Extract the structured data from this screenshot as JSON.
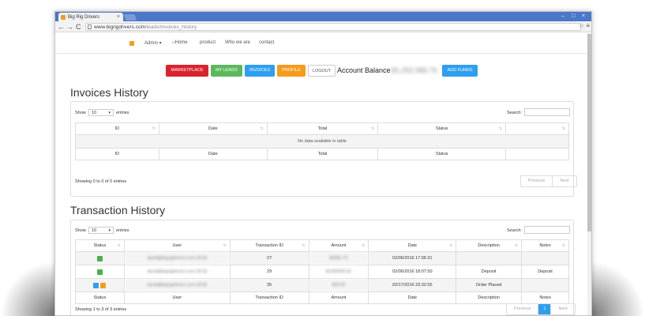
{
  "browser": {
    "tab_title": "Big Rig Drivers",
    "url_host": "www.bigrigdrivers.com",
    "url_path": "/leads/invoices_history",
    "tab_close": "×",
    "min": "–",
    "max": "□",
    "close": "×",
    "back": "←",
    "forward": "→",
    "reload": "C",
    "star": "☆",
    "menu": "≡"
  },
  "nav": {
    "admin": "Admin ▾",
    "home": "Home",
    "product": "product",
    "who": "Who we are",
    "contact": "contact"
  },
  "actions": {
    "marketplace": "MARKETPLACE",
    "my_leads": "MY LEADS",
    "invoices": "INVOICES",
    "profile": "PROFILE",
    "logout": "LOGOUT",
    "balance_label": "Account Balance",
    "balance_value": "$1,252,986.76",
    "add_funds": "ADD FUNDS"
  },
  "colors": {
    "red": "#d9232e",
    "green": "#5cb85c",
    "blue": "#2e9ff0",
    "orange": "#f59c1a"
  },
  "invoices": {
    "title": "Invoices History",
    "show": "Show",
    "page_size": "10",
    "entries": "entries",
    "search": "Search:",
    "columns": [
      "ID",
      "Date",
      "Total",
      "Status",
      ""
    ],
    "empty": "No data available in table",
    "footer": [
      "ID",
      "Date",
      "Total",
      "Status",
      ""
    ],
    "info": "Showing 0 to 0 of 0 entries",
    "prev": "Previous",
    "next": "Next"
  },
  "transactions": {
    "title": "Transaction History",
    "show": "Show",
    "page_size": "10",
    "entries": "entries",
    "search": "Search:",
    "columns": [
      "Status",
      "User",
      "Transaction ID",
      "Amount",
      "Date",
      "Description",
      "Notes"
    ],
    "rows": [
      {
        "icons": [
          "green"
        ],
        "user": "david@bigrigdrivers.com (ID:8)",
        "tid": "27",
        "amount": "$5981.75",
        "date": "02/06/2016 17:06:31",
        "desc": "",
        "notes": ""
      },
      {
        "icons": [
          "green"
        ],
        "user": "david@bigrigdrivers.com (ID:8)",
        "tid": "29",
        "amount": "$1000000.00",
        "date": "02/06/2016 18:07:50",
        "desc": "Deposit",
        "notes": "Deposit"
      },
      {
        "icons": [
          "blue",
          "orange"
        ],
        "user": "david@bigrigdrivers.com (ID:8)",
        "tid": "35",
        "amount": "$33.00",
        "date": "02/17/2016 23:32:55",
        "desc": "Order Placed",
        "notes": ""
      }
    ],
    "footer": [
      "Status",
      "User",
      "Transaction ID",
      "Amount",
      "Date",
      "Description",
      "Notes"
    ],
    "info": "Showing 1 to 3 of 3 entries",
    "prev": "Previous",
    "page": "1",
    "next": "Next"
  }
}
